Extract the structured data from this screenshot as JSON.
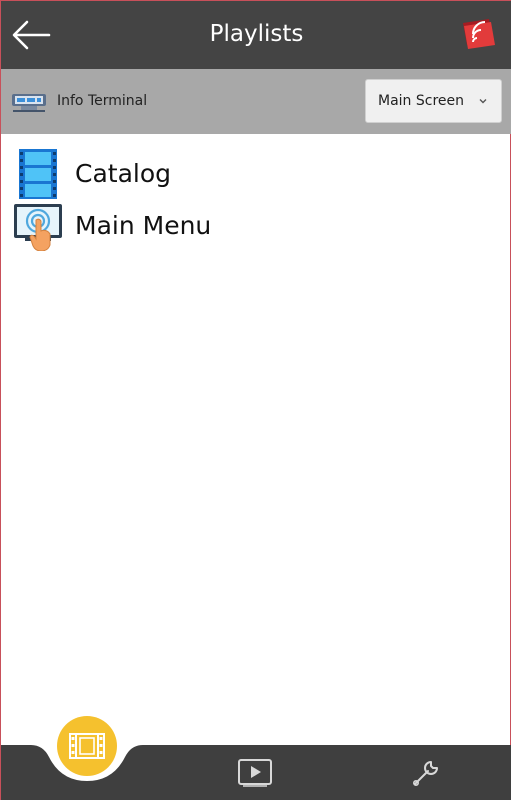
{
  "header": {
    "title": "Playlists",
    "back_icon": "arrow-left-icon",
    "cast_icon": "cast-icon"
  },
  "device_bar": {
    "device_icon": "display-device-icon",
    "device_name": "Info Terminal",
    "screen_select": {
      "selected": "Main Screen",
      "icon": "chevron-down-icon"
    }
  },
  "playlists": [
    {
      "label": "Catalog",
      "icon": "film-strip-icon"
    },
    {
      "label": "Main Menu",
      "icon": "touch-screen-icon"
    }
  ],
  "bottom_nav": {
    "tabs": [
      {
        "name": "playlists",
        "icon": "film-icon",
        "active": true
      },
      {
        "name": "player",
        "icon": "play-icon",
        "active": false
      },
      {
        "name": "settings",
        "icon": "wrench-icon",
        "active": false
      }
    ],
    "colors": {
      "bar": "#3f3f3f",
      "active": "#f5c12e"
    }
  }
}
